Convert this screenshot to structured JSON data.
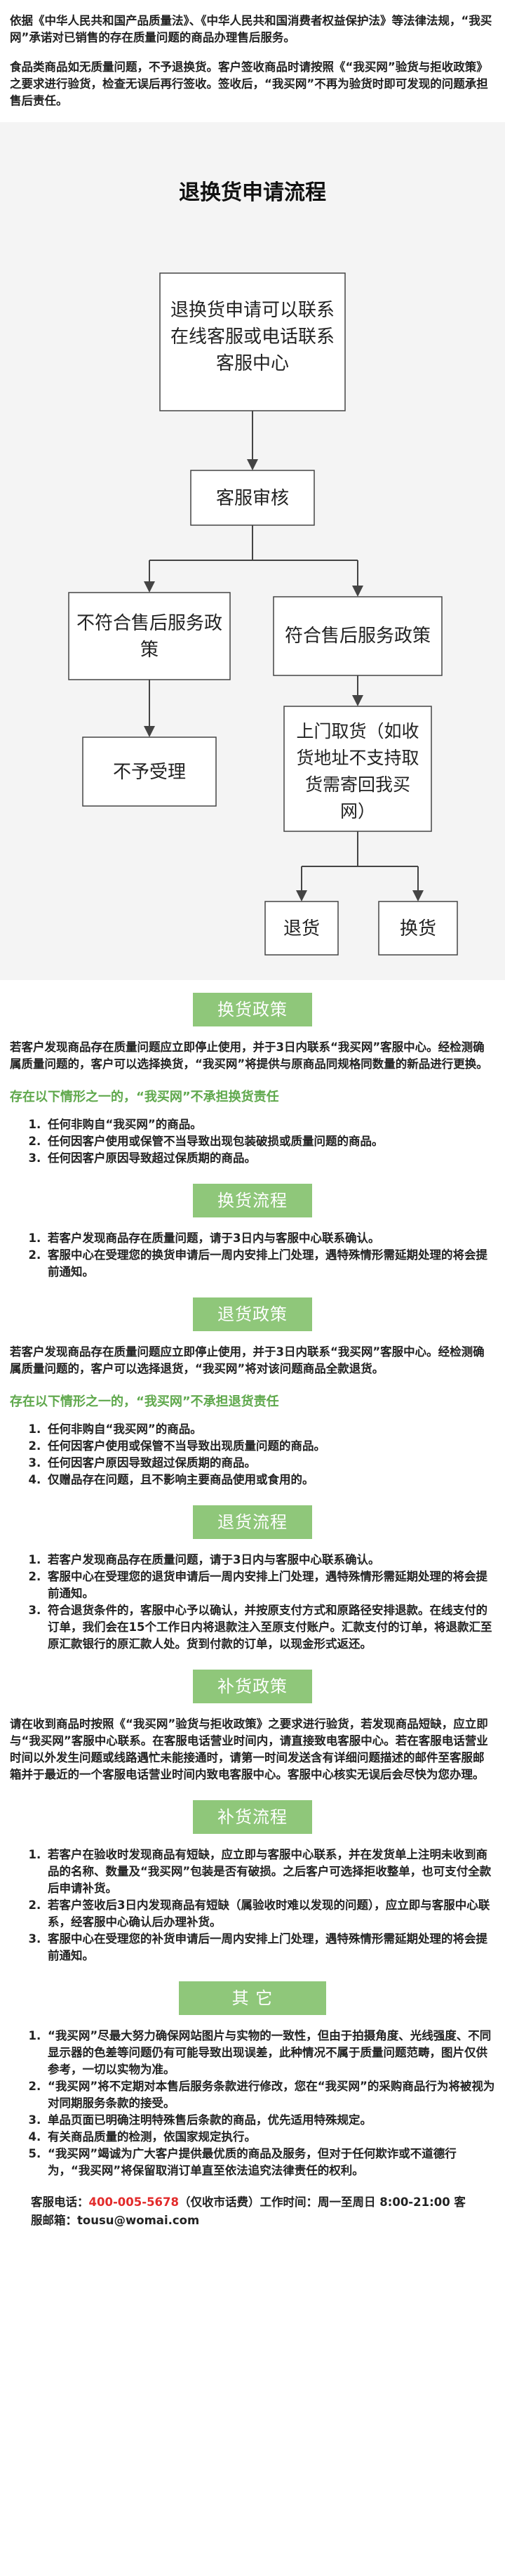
{
  "intro": {
    "p1": "依据《中华人民共和国产品质量法》、《中华人民共和国消费者权益保护法》等法律法规，“我买网”承诺对已销售的存在质量问题的商品办理售后服务。",
    "p2": "食品类商品如无质量问题，不予退换货。客户签收商品时请按照《“我买网”验货与拒收政策》之要求进行验货，检查无误后再行签收。签收后，“我买网”不再为验货时即可发现的问题承担售后责任。"
  },
  "flow": {
    "title": "退换货申请流程",
    "start": [
      "退换货申请可以联系",
      "在线客服或电话联系",
      "客服中心"
    ],
    "review": "客服审核",
    "reject_condition": [
      "不符合售后服务政",
      "策"
    ],
    "accept_condition": "符合售后服务政策",
    "reject_result": "不予受理",
    "pickup": [
      "上门取货（如收",
      "货地址不支持取",
      "货需寄回我买",
      "网）"
    ],
    "return": "退货",
    "exchange": "换货"
  },
  "exchange_policy": {
    "title": "换货政策",
    "body": "若客户发现商品存在质量问题应立即停止使用，并于3日内联系“我买网”客服中心。经检测确属质量问题的，客户可以选择换货，“我买网”将提供与原商品同规格同数量的新品进行更换。",
    "exclusion_head": "存在以下情形之一的，“我买网”不承担换货责任",
    "items": [
      "任何非购自“我买网”的商品。",
      "任何因客户使用或保管不当导致出现包装破损或质量问题的商品。",
      "任何因客户原因导致超过保质期的商品。"
    ]
  },
  "exchange_process": {
    "title": "换货流程",
    "items": [
      "若客户发现商品存在质量问题，请于3日内与客服中心联系确认。",
      "客服中心在受理您的换货申请后一周内安排上门处理，遇特殊情形需延期处理的将会提前通知。"
    ]
  },
  "return_policy": {
    "title": "退货政策",
    "body": "若客户发现商品存在质量问题应立即停止使用，并于3日内联系“我买网”客服中心。经检测确属质量问题的，客户可以选择退货，“我买网”将对该问题商品全款退货。",
    "exclusion_head": "存在以下情形之一的，“我买网”不承担退货责任",
    "items": [
      "任何非购自“我买网”的商品。",
      "任何因客户使用或保管不当导致出现质量问题的商品。",
      "任何因客户原因导致超过保质期的商品。",
      "仅赠品存在问题，且不影响主要商品使用或食用的。"
    ]
  },
  "return_process": {
    "title": "退货流程",
    "items": [
      "若客户发现商品存在质量问题，请于3日内与客服中心联系确认。",
      "客服中心在受理您的退货申请后一周内安排上门处理，遇特殊情形需延期处理的将会提前通知。",
      "符合退货条件的，客服中心予以确认，并按原支付方式和原路径安排退款。在线支付的订单，我们会在15个工作日内将退款注入至原支付账户。汇款支付的订单，将退款汇至原汇款银行的原汇款人处。货到付款的订单，以现金形式返还。"
    ]
  },
  "replenish_policy": {
    "title": "补货政策",
    "body": "请在收到商品时按照《“我买网”验货与拒收政策》之要求进行验货，若发现商品短缺，应立即与“我买网”客服中心联系。在客服电话营业时间内，请直接致电客服中心。若在客服电话营业时间以外发生问题或线路遇忙未能接通时，请第一时间发送含有详细问题描述的邮件至客服邮箱并于最近的一个客服电话营业时间内致电客服中心。客服中心核实无误后会尽快为您办理。"
  },
  "replenish_process": {
    "title": "补货流程",
    "items": [
      "若客户在验收时发现商品有短缺，应立即与客服中心联系，并在发货单上注明未收到商品的名称、数量及“我买网”包装是否有破损。之后客户可选择拒收整单，也可支付全款后申请补货。",
      "若客户签收后3日内发现商品有短缺（属验收时难以发现的问题），应立即与客服中心联系，经客服中心确认后办理补货。",
      "客服中心在受理您的补货申请后一周内安排上门处理，遇特殊情形需延期处理的将会提前通知。"
    ]
  },
  "other": {
    "title": "其 它",
    "items": [
      "“我买网”尽最大努力确保网站图片与实物的一致性，但由于拍摄角度、光线强度、不同显示器的色差等问题仍有可能导致出现误差，此种情况不属于质量问题范畴，图片仅供参考，一切以实物为准。",
      "“我买网”将不定期对本售后服务条款进行修改，您在“我买网”的采购商品行为将被视为对同期服务条款的接受。",
      "单品页面已明确注明特殊售后条款的商品，优先适用特殊规定。",
      "有关商品质量的检测，依国家规定执行。",
      "“我买网”竭诚为广大客户提供最优质的商品及服务，但对于任何欺诈或不道德行为，“我买网”将保留取消订单直至依法追究法律责任的权利。"
    ]
  },
  "contact": {
    "phone_label": "客服电话：",
    "phone": "400-005-5678",
    "phone_note": "（仅收市话费）工作时间：周一至周日 8:00-21:00 客服邮箱：",
    "email": "tousu@womai.com"
  },
  "colors": {
    "accent_green": "#8fc77a",
    "text_green": "#5fa84c",
    "phone_red": "#e22b2b",
    "flow_bg": "#f4f4f4"
  }
}
